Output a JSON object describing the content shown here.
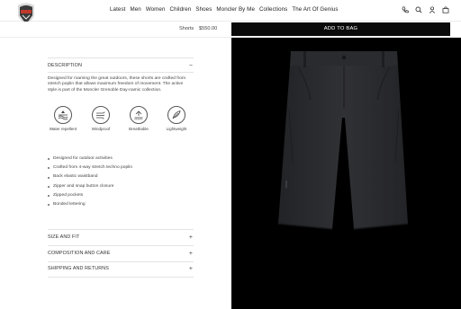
{
  "brand": {
    "logo_icon": "moncler-logo"
  },
  "nav": {
    "items": [
      "Latest",
      "Men",
      "Women",
      "Children",
      "Shoes",
      "Moncler By Me",
      "Collections",
      "The Art Of Genius"
    ]
  },
  "header_icons": [
    "phone-icon",
    "search-icon",
    "account-icon",
    "bag-icon"
  ],
  "subbar": {
    "product_name": "Shorts",
    "price": "$550.00",
    "add_to_bag": "ADD TO BAG"
  },
  "description": {
    "heading": "DESCRIPTION",
    "toggle": "−",
    "text": "Designed for roaming the great outdoors, these shorts are crafted from stretch poplin that allows maximum freedom of movement. The active style is part of the Moncler Grenoble Day-namic collection.",
    "features": [
      {
        "label": "Water repellent",
        "icon": "water-repellent-icon"
      },
      {
        "label": "Windproof",
        "icon": "windproof-icon"
      },
      {
        "label": "Breathable",
        "icon": "breathable-icon"
      },
      {
        "label": "Lightweight",
        "icon": "lightweight-icon"
      }
    ],
    "bullets": [
      "Designed for outdoor activities",
      "Crafted from 4-way stretch techno poplin",
      "Back elastic waistband",
      "Zipper and snap button closure",
      "Zipped pockets",
      "Bonded lettering"
    ]
  },
  "accordions": [
    {
      "label": "SIZE AND FIT",
      "toggle": "+"
    },
    {
      "label": "COMPOSITION AND CARE",
      "toggle": "+"
    },
    {
      "label": "SHIPPING AND RETURNS",
      "toggle": "+"
    }
  ],
  "colors": {
    "button_bg": "#0a0a0a",
    "image_bg": "#000000",
    "garment": "#2b2c2f"
  }
}
